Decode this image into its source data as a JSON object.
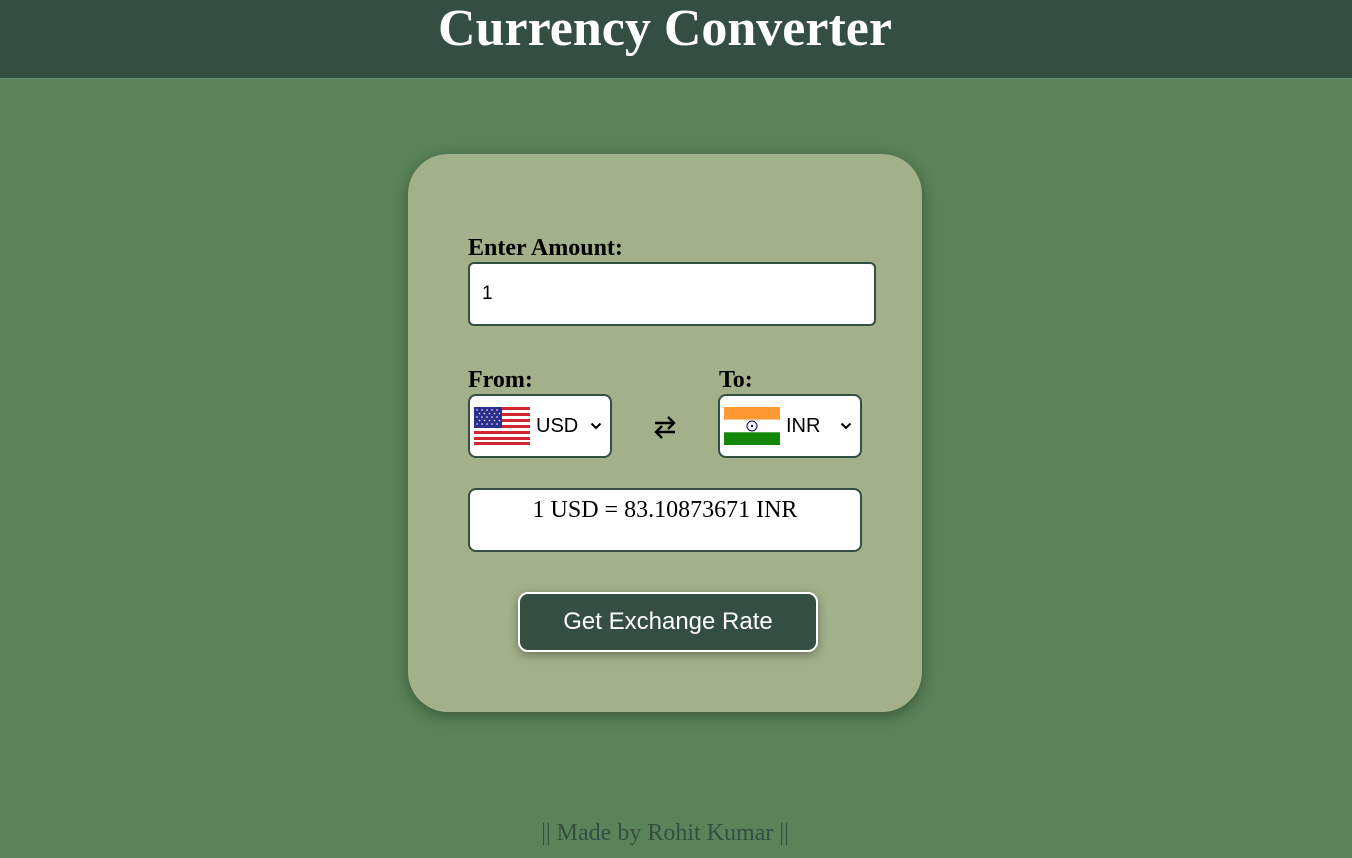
{
  "header": {
    "title": "Currency Converter"
  },
  "form": {
    "amount_label": "Enter Amount:",
    "amount_value": "1",
    "from_label": "From:",
    "to_label": "To:",
    "from_currency": "USD",
    "from_flag": "us-flag-icon",
    "to_currency": "INR",
    "to_flag": "india-flag-icon",
    "swap_icon": "swap-arrows-icon",
    "result_text": "1 USD = 83.10873671 INR",
    "button_label": "Get Exchange Rate"
  },
  "footer": {
    "text": "|| Made by Rohit Kumar ||"
  },
  "colors": {
    "background": "#5a8359",
    "header": "#344e41",
    "card": "#a3b18a",
    "button": "#344e41"
  }
}
